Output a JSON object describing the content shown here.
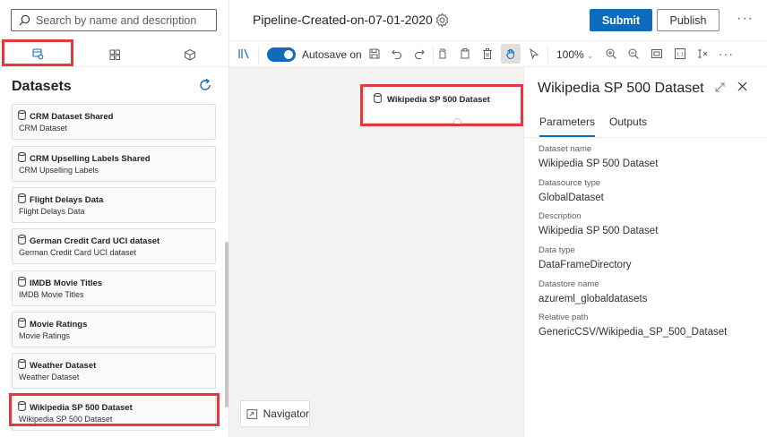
{
  "search": {
    "placeholder": "Search by name and description"
  },
  "left_panel": {
    "title": "Datasets",
    "datasets": [
      {
        "name": "CRM Dataset Shared",
        "subtitle": "CRM Dataset"
      },
      {
        "name": "CRM Upselling Labels Shared",
        "subtitle": "CRM Upselling Labels"
      },
      {
        "name": "Flight Delays Data",
        "subtitle": "Flight Delays Data"
      },
      {
        "name": "German Credit Card UCI dataset",
        "subtitle": "German Credit Card UCI dataset"
      },
      {
        "name": "IMDB Movie Titles",
        "subtitle": "IMDB Movie Titles"
      },
      {
        "name": "Movie Ratings",
        "subtitle": "Movie Ratings"
      },
      {
        "name": "Weather Dataset",
        "subtitle": "Weather Dataset"
      },
      {
        "name": "Wikipedia SP 500 Dataset",
        "subtitle": "Wikipedia SP 500 Dataset"
      }
    ]
  },
  "header": {
    "pipeline_title": "Pipeline-Created-on-07-01-2020",
    "submit_label": "Submit",
    "publish_label": "Publish",
    "more_label": "···"
  },
  "toolbar": {
    "autosave_label": "Autosave on",
    "autosave_on": true,
    "zoom_label": "100%",
    "more_label": "···"
  },
  "canvas": {
    "node_label": "Wikipedia SP 500 Dataset",
    "navigator_label": "Navigator"
  },
  "properties": {
    "title": "Wikipedia SP 500 Dataset",
    "tabs": [
      "Parameters",
      "Outputs"
    ],
    "active_tab": "Parameters",
    "fields": [
      {
        "label": "Dataset name",
        "value": "Wikipedia SP 500 Dataset"
      },
      {
        "label": "Datasource type",
        "value": "GlobalDataset"
      },
      {
        "label": "Description",
        "value": "Wikipedia SP 500 Dataset"
      },
      {
        "label": "Data type",
        "value": "DataFrameDirectory"
      },
      {
        "label": "Datastore name",
        "value": "azureml_globaldatasets"
      },
      {
        "label": "Relative path",
        "value": "GenericCSV/Wikipedia_SP_500_Dataset"
      }
    ]
  },
  "colors": {
    "accent": "#0f6cbd",
    "highlight_box": "#e0393e",
    "canvas_bg": "#f3f2f1",
    "card_bg": "#fbf9fc"
  },
  "icons": {
    "left_tabs": [
      "datasets-icon",
      "modules-icon",
      "package-icon"
    ],
    "toolbar": [
      "library-icon",
      "save-icon",
      "undo-icon",
      "redo-icon",
      "copy-icon",
      "paste-icon",
      "delete-icon",
      "pan-hand-icon",
      "pointer-icon",
      "zoom-in-icon",
      "zoom-out-icon",
      "fit-screen-icon",
      "actual-size-icon",
      "auto-layout-icon"
    ]
  }
}
